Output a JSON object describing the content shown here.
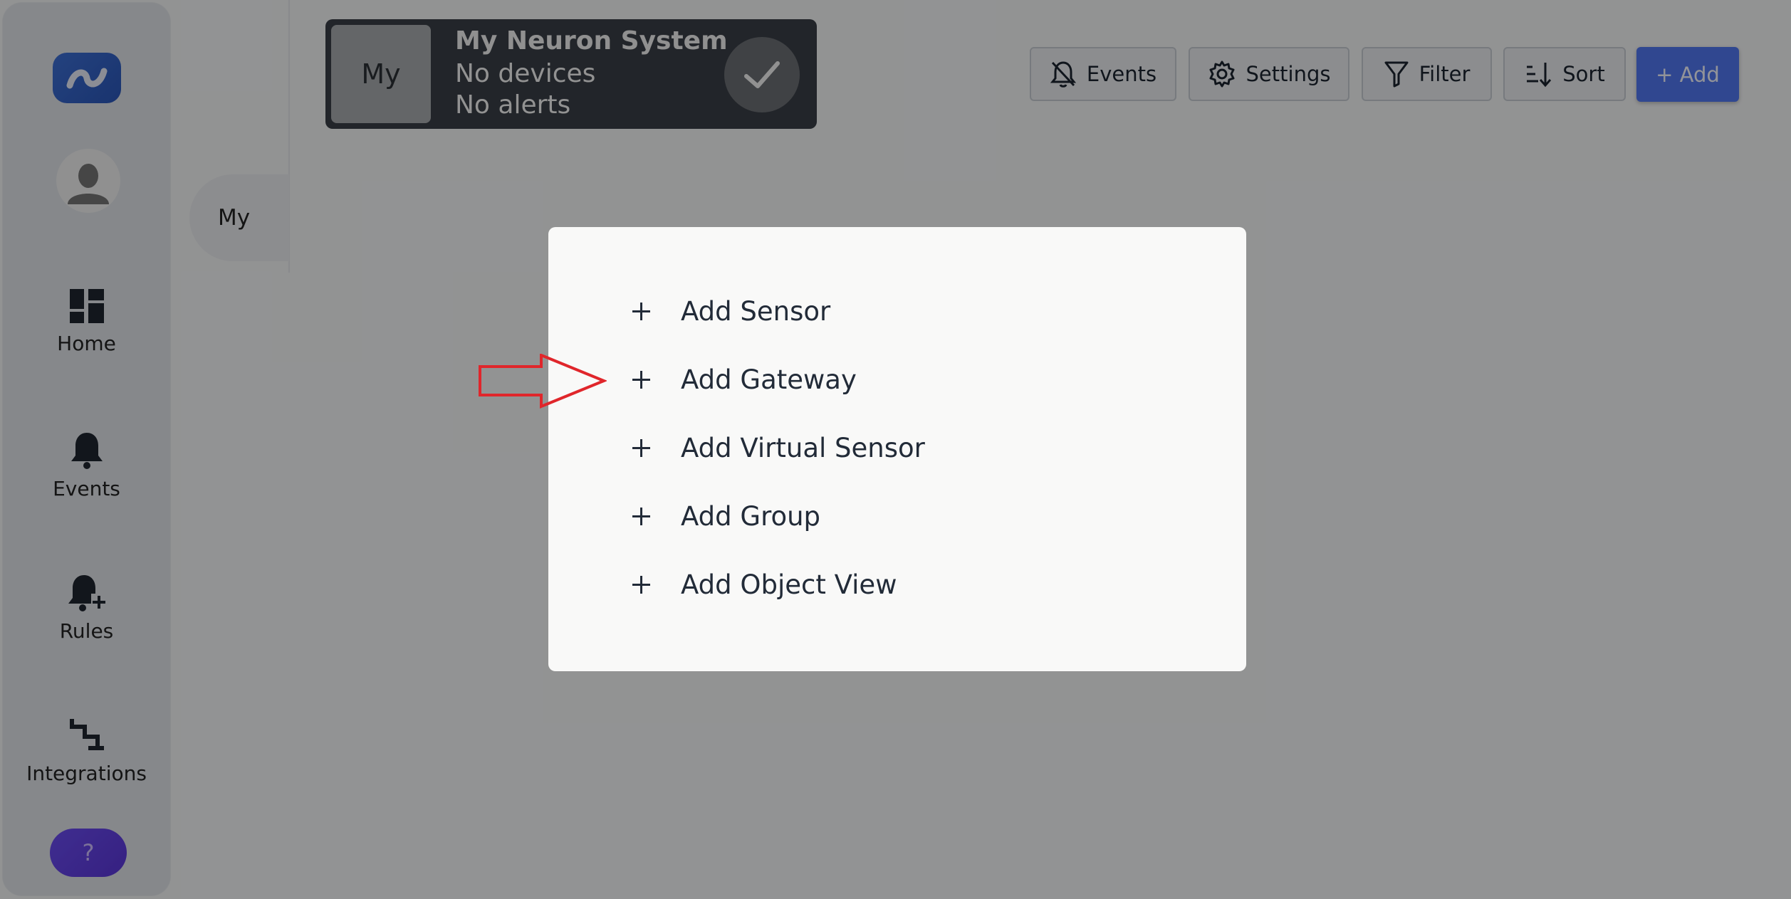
{
  "sidebar": {
    "nav": [
      {
        "label": "Home",
        "icon": "dashboard-icon"
      },
      {
        "label": "Events",
        "icon": "bell-icon"
      },
      {
        "label": "Rules",
        "icon": "bell-plus-icon"
      },
      {
        "label": "Integrations",
        "icon": "integrations-icon"
      }
    ],
    "help_label": "?"
  },
  "system_list": {
    "pill_label": "My"
  },
  "system_card": {
    "thumb_label": "My",
    "title": "My Neuron System",
    "devices": "No devices",
    "alerts": "No alerts"
  },
  "toolbar": {
    "events_label": "Events",
    "settings_label": "Settings",
    "filter_label": "Filter",
    "sort_label": "Sort",
    "add_label": "+ Add"
  },
  "add_menu": {
    "items": [
      {
        "label": "Add Sensor"
      },
      {
        "label": "Add Gateway"
      },
      {
        "label": "Add Virtual Sensor"
      },
      {
        "label": "Add Group"
      },
      {
        "label": "Add Object View"
      }
    ]
  },
  "colors": {
    "accent": "#5177f0",
    "annotation_arrow": "#e0262b",
    "card_dark": "#3a3f46"
  }
}
